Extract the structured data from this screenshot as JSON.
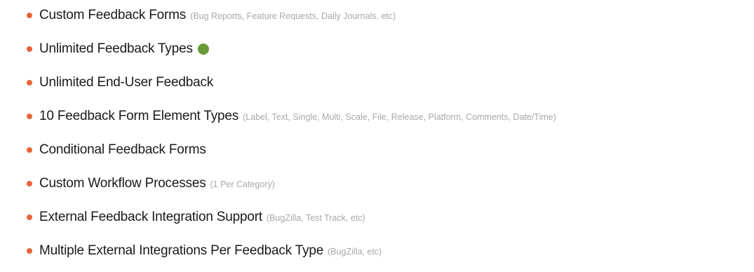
{
  "features": [
    {
      "text": "Custom Feedback Forms",
      "note": "(Bug Reports, Feature Requests, Daily Journals, etc)"
    },
    {
      "text": "Unlimited Feedback Types",
      "note": "",
      "has_dot": true
    },
    {
      "text": "Unlimited End-User Feedback",
      "note": ""
    },
    {
      "text": "10 Feedback Form Element Types",
      "note": "(Label, Text, Single, Multi, Scale, File, Release, Platform, Comments, Date/Time)"
    },
    {
      "text": "Conditional Feedback Forms",
      "note": ""
    },
    {
      "text": "Custom Workflow Processes",
      "note": "(1 Per Category)"
    },
    {
      "text": "External Feedback Integration Support",
      "note": "(BugZilla, Test Track, etc)"
    },
    {
      "text": "Multiple External Integrations Per Feedback Type",
      "note": "(BugZilla, etc)"
    }
  ],
  "colors": {
    "bullet": "#e8643a",
    "status_dot": "#6a9a3a"
  }
}
